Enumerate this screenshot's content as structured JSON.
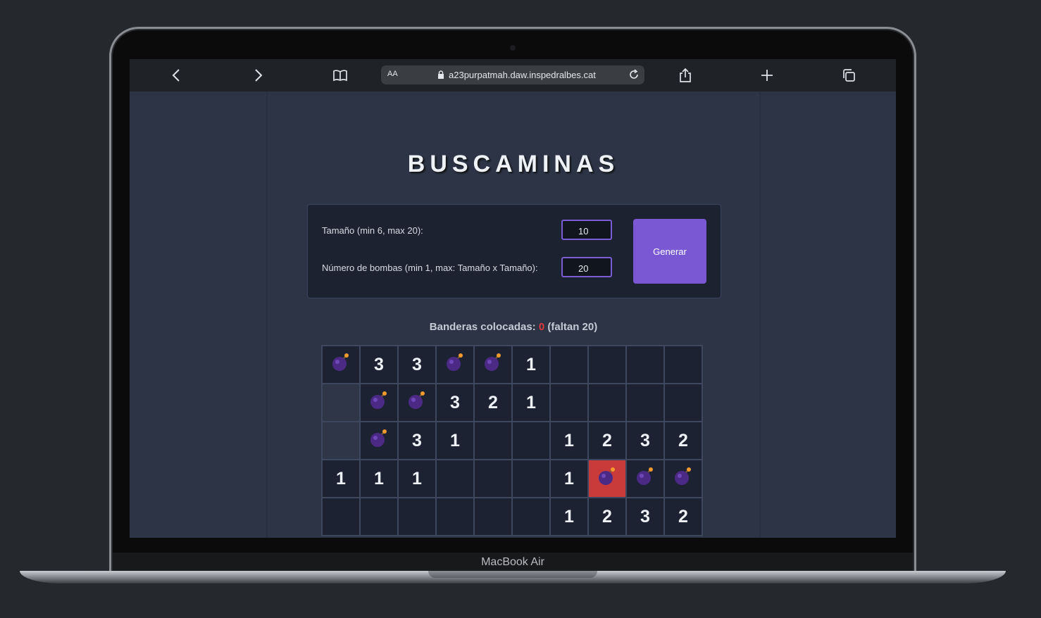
{
  "device": {
    "label": "MacBook Air"
  },
  "browser": {
    "text_size_label": "AA",
    "url": "a23purpatmah.daw.inspedralbes.cat",
    "icons": [
      "back-icon",
      "forward-icon",
      "bookmarks-icon",
      "lock-icon",
      "reload-icon",
      "share-icon",
      "new-tab-icon",
      "tabs-icon"
    ]
  },
  "app": {
    "title": "BUSCAMINAS",
    "size_label": "Tamaño (min 6, max 20):",
    "size_value": "10",
    "bombs_label": "Número de bombas (min 1, max: Tamaño x Tamaño):",
    "bombs_value": "20",
    "generate_label": "Generar",
    "flags_prefix": "Banderas colocadas:",
    "flags_count": "0",
    "flags_suffix": "(faltan 20)",
    "accent": "#7b58d3",
    "exploded_color": "#c93a3a"
  },
  "board": {
    "rows": [
      [
        "B",
        "3",
        "3",
        "B",
        "B",
        "1",
        "",
        "",
        "",
        ""
      ],
      [
        "H",
        "B",
        "B",
        "3",
        "2",
        "1",
        "",
        "",
        "",
        ""
      ],
      [
        "H",
        "B",
        "3",
        "1",
        "",
        "",
        "1",
        "2",
        "3",
        "2"
      ],
      [
        "1",
        "1",
        "1",
        "",
        "",
        "",
        "1",
        "X",
        "B",
        "B"
      ],
      [
        "",
        "",
        "",
        "",
        "",
        "",
        "1",
        "2",
        "3",
        "2"
      ]
    ]
  }
}
